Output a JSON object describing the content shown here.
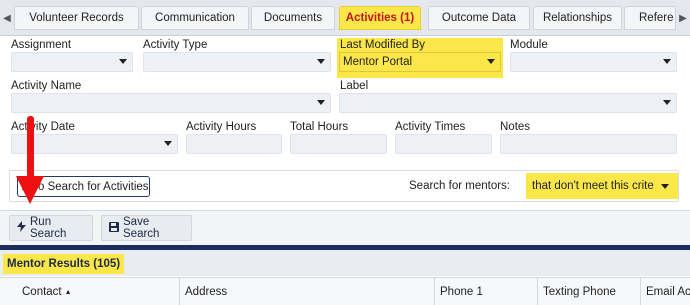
{
  "tabs": [
    {
      "label": "Volunteer Records",
      "active": false
    },
    {
      "label": "Communication",
      "active": false
    },
    {
      "label": "Documents",
      "active": false
    },
    {
      "label": "Activities (1)",
      "active": true
    },
    {
      "label": "Outcome Data",
      "active": false
    },
    {
      "label": "Relationships",
      "active": false
    },
    {
      "label": "Refere",
      "active": false
    }
  ],
  "filters": {
    "assignment_label": "Assignment",
    "activity_type_label": "Activity Type",
    "last_modified_label": "Last Modified By",
    "last_modified_value": "Mentor Portal",
    "module_label": "Module",
    "activity_name_label": "Activity Name",
    "label_label": "Label",
    "activity_date_label": "Activity Date",
    "activity_hours_label": "Activity Hours",
    "total_hours_label": "Total Hours",
    "activity_times_label": "Activity Times",
    "notes_label": "Notes",
    "also_search_label": "Also Search for Activities",
    "search_mentors_label": "Search for mentors:",
    "search_mentors_value": "that don't meet this crite"
  },
  "toolbar": {
    "run_label": "Run Search",
    "save_label": "Save Search"
  },
  "results": {
    "title": "Mentor Results (105)",
    "columns": [
      "Contact",
      "Address",
      "Phone 1",
      "Texting Phone",
      "Email Ac"
    ]
  },
  "colors": {
    "highlight": "#fbe74a",
    "navy": "#1b2d5c",
    "annotation_arrow": "#ee1111"
  },
  "icons": {
    "run": "lightning-bolt-icon",
    "save": "floppy-disk-icon",
    "sort": "sort-ascending-icon"
  }
}
